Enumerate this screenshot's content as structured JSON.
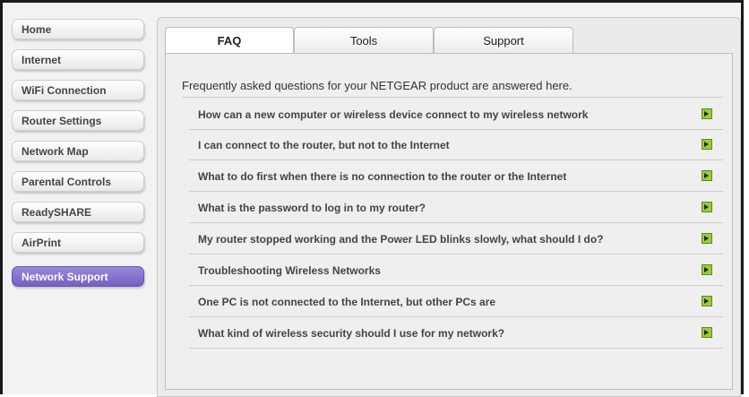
{
  "sidebar": {
    "items": [
      {
        "label": "Home",
        "active": false
      },
      {
        "label": "Internet",
        "active": false
      },
      {
        "label": "WiFi Connection",
        "active": false
      },
      {
        "label": "Router Settings",
        "active": false
      },
      {
        "label": "Network Map",
        "active": false
      },
      {
        "label": "Parental Controls",
        "active": false
      },
      {
        "label": "ReadySHARE",
        "active": false
      },
      {
        "label": "AirPrint",
        "active": false
      },
      {
        "label": "Network Support",
        "active": true
      }
    ],
    "active_color": "#7f6bcb"
  },
  "tabs": [
    {
      "label": "FAQ",
      "active": true
    },
    {
      "label": "Tools",
      "active": false
    },
    {
      "label": "Support",
      "active": false
    }
  ],
  "faq": {
    "intro": "Frequently asked questions for your NETGEAR product are answered here.",
    "expand_icon": "expand-plus-icon",
    "questions": [
      "How can a new computer or wireless device connect to my wireless network",
      "I can connect to the router, but not to the Internet",
      "What to do first when there is no connection to the router or the Internet",
      "What is the password to log in to my router?",
      "My router stopped working and the Power LED blinks slowly, what should I do?",
      "Troubleshooting Wireless Networks",
      "One PC is not connected to the Internet, but other PCs are",
      "What kind of wireless security should I use for my network?"
    ]
  }
}
